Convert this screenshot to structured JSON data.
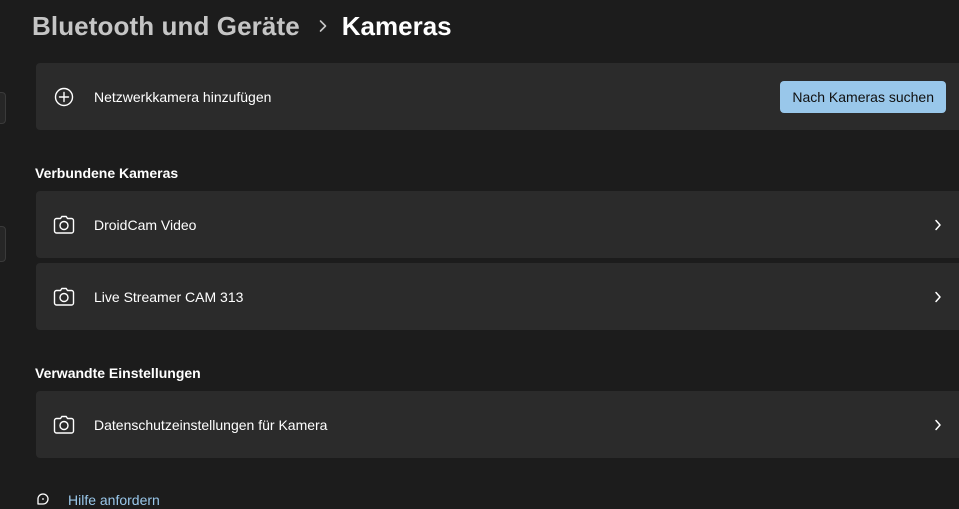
{
  "breadcrumb": {
    "parent": "Bluetooth und Geräte",
    "separator_icon": "chevron-right-icon",
    "current": "Kameras"
  },
  "add_camera": {
    "icon": "add-circle-icon",
    "label": "Netzwerkkamera hinzufügen",
    "button_label": "Nach Kameras suchen",
    "button_color": "#99c7ea"
  },
  "connected": {
    "title": "Verbundene Kameras",
    "items": [
      {
        "icon": "camera-icon",
        "label": "DroidCam Video"
      },
      {
        "icon": "camera-icon",
        "label": "Live Streamer CAM 313"
      }
    ]
  },
  "related": {
    "title": "Verwandte Einstellungen",
    "items": [
      {
        "icon": "camera-icon",
        "label": "Datenschutzeinstellungen für Kamera"
      }
    ]
  },
  "help": {
    "icon": "help-chat-icon",
    "label": "Hilfe anfordern",
    "link_color": "#99c7ea"
  },
  "colors": {
    "background": "#1c1c1c",
    "card": "#2b2b2b",
    "accent": "#99c7ea"
  }
}
